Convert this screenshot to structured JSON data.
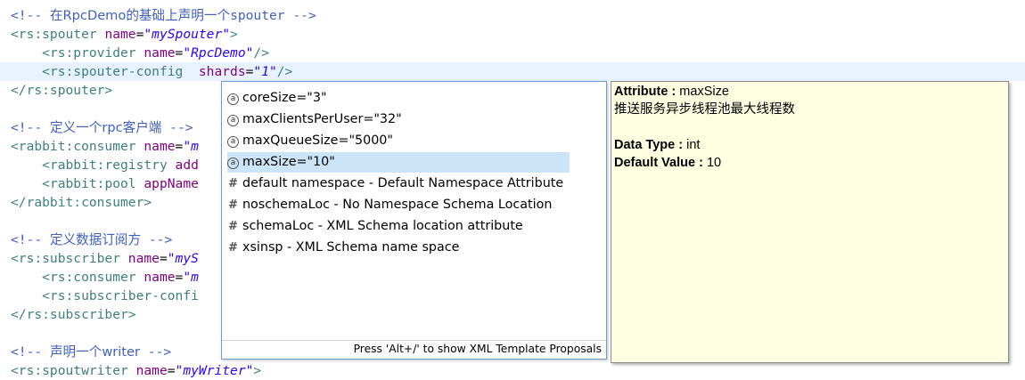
{
  "editor": {
    "lines": [
      [
        {
          "c": "comment",
          "t": "<!-- "
        },
        {
          "c": "comment cjk",
          "t": "在RpcDemo的基础上声明一个"
        },
        {
          "c": "comment",
          "t": "spouter -->"
        }
      ],
      [
        {
          "c": "tag",
          "t": "<rs:spouter "
        },
        {
          "c": "attr",
          "t": "name"
        },
        {
          "c": "plain",
          "t": "="
        },
        {
          "c": "val",
          "t": "\"mySpouter\""
        },
        {
          "c": "tag",
          "t": ">"
        }
      ],
      [
        {
          "c": "plain",
          "t": "    "
        },
        {
          "c": "tag",
          "t": "<rs:provider "
        },
        {
          "c": "attr",
          "t": "name"
        },
        {
          "c": "plain",
          "t": "="
        },
        {
          "c": "val",
          "t": "\"RpcDemo\""
        },
        {
          "c": "tag",
          "t": "/>"
        }
      ],
      [
        {
          "c": "plain",
          "t": "    "
        },
        {
          "c": "tag",
          "t": "<rs:spouter-config  "
        },
        {
          "c": "attr",
          "t": "shards"
        },
        {
          "c": "plain",
          "t": "="
        },
        {
          "c": "val",
          "t": "\"1\""
        },
        {
          "c": "tag",
          "t": "/>"
        }
      ],
      [
        {
          "c": "tag",
          "t": "</rs:spouter>"
        }
      ],
      [],
      [
        {
          "c": "comment",
          "t": "<!-- "
        },
        {
          "c": "comment cjk",
          "t": "定义一个rpc客户端"
        },
        {
          "c": "comment",
          "t": " -->"
        }
      ],
      [
        {
          "c": "tag",
          "t": "<rabbit:consumer "
        },
        {
          "c": "attr",
          "t": "name"
        },
        {
          "c": "plain",
          "t": "="
        },
        {
          "c": "val",
          "t": "\"m"
        }
      ],
      [
        {
          "c": "plain",
          "t": "    "
        },
        {
          "c": "tag",
          "t": "<rabbit:registry "
        },
        {
          "c": "attr",
          "t": "add"
        }
      ],
      [
        {
          "c": "plain",
          "t": "    "
        },
        {
          "c": "tag",
          "t": "<rabbit:pool "
        },
        {
          "c": "attr",
          "t": "appName"
        }
      ],
      [
        {
          "c": "tag",
          "t": "</rabbit:consumer>"
        }
      ],
      [],
      [
        {
          "c": "comment",
          "t": "<!-- "
        },
        {
          "c": "comment cjk",
          "t": "定义数据订阅方"
        },
        {
          "c": "comment",
          "t": " -->"
        }
      ],
      [
        {
          "c": "tag",
          "t": "<rs:subscriber "
        },
        {
          "c": "attr",
          "t": "name"
        },
        {
          "c": "plain",
          "t": "="
        },
        {
          "c": "val",
          "t": "\"myS"
        }
      ],
      [
        {
          "c": "plain",
          "t": "    "
        },
        {
          "c": "tag",
          "t": "<rs:consumer "
        },
        {
          "c": "attr",
          "t": "name"
        },
        {
          "c": "plain",
          "t": "="
        },
        {
          "c": "val",
          "t": "\"m"
        }
      ],
      [
        {
          "c": "plain",
          "t": "    "
        },
        {
          "c": "tag",
          "t": "<rs:subscriber-confi"
        }
      ],
      [
        {
          "c": "tag",
          "t": "</rs:subscriber>"
        }
      ],
      [],
      [
        {
          "c": "comment",
          "t": "<!-- "
        },
        {
          "c": "comment cjk",
          "t": "声明一个writer"
        },
        {
          "c": "comment",
          "t": " -->"
        }
      ],
      [
        {
          "c": "tag",
          "t": "<rs:spoutwriter "
        },
        {
          "c": "attr",
          "t": "name"
        },
        {
          "c": "plain",
          "t": "="
        },
        {
          "c": "val",
          "t": "\"myWriter\""
        },
        {
          "c": "tag",
          "t": ">"
        }
      ]
    ]
  },
  "proposals": {
    "items": [
      {
        "icon": "attribute-icon",
        "glyph": "a",
        "label": "coreSize=\"3\""
      },
      {
        "icon": "attribute-icon",
        "glyph": "a",
        "label": "maxClientsPerUser=\"32\""
      },
      {
        "icon": "attribute-icon",
        "glyph": "a",
        "label": "maxQueueSize=\"5000\""
      },
      {
        "icon": "attribute-icon",
        "glyph": "a",
        "label": "maxSize=\"10\"",
        "selected": true
      },
      {
        "icon": "hash-icon",
        "glyph": "#",
        "label": "default namespace - Default Namespace Attribute"
      },
      {
        "icon": "hash-icon",
        "glyph": "#",
        "label": "noschemaLoc - No Namespace Schema Location"
      },
      {
        "icon": "hash-icon",
        "glyph": "#",
        "label": "schemaLoc - XML Schema location attribute"
      },
      {
        "icon": "hash-icon",
        "glyph": "#",
        "label": "xsinsp - XML Schema name space"
      }
    ],
    "footer": "Press 'Alt+/' to show XML Template Proposals"
  },
  "doc": {
    "attribute_key": "Attribute : ",
    "attribute_value": "maxSize",
    "description": "推送服务异步线程池最大线程数",
    "type_key": "Data Type : ",
    "type_value": "int",
    "default_key": "Default Value : ",
    "default_value": "10"
  },
  "colors": {
    "comment": "#3f5fbf",
    "tag": "#3f7f7f",
    "attribute": "#7f007f",
    "value": "#2a00ff",
    "current_line": "#e8f2fe",
    "selection": "#cce4f7",
    "tooltip_bg": "#ffffe1"
  }
}
